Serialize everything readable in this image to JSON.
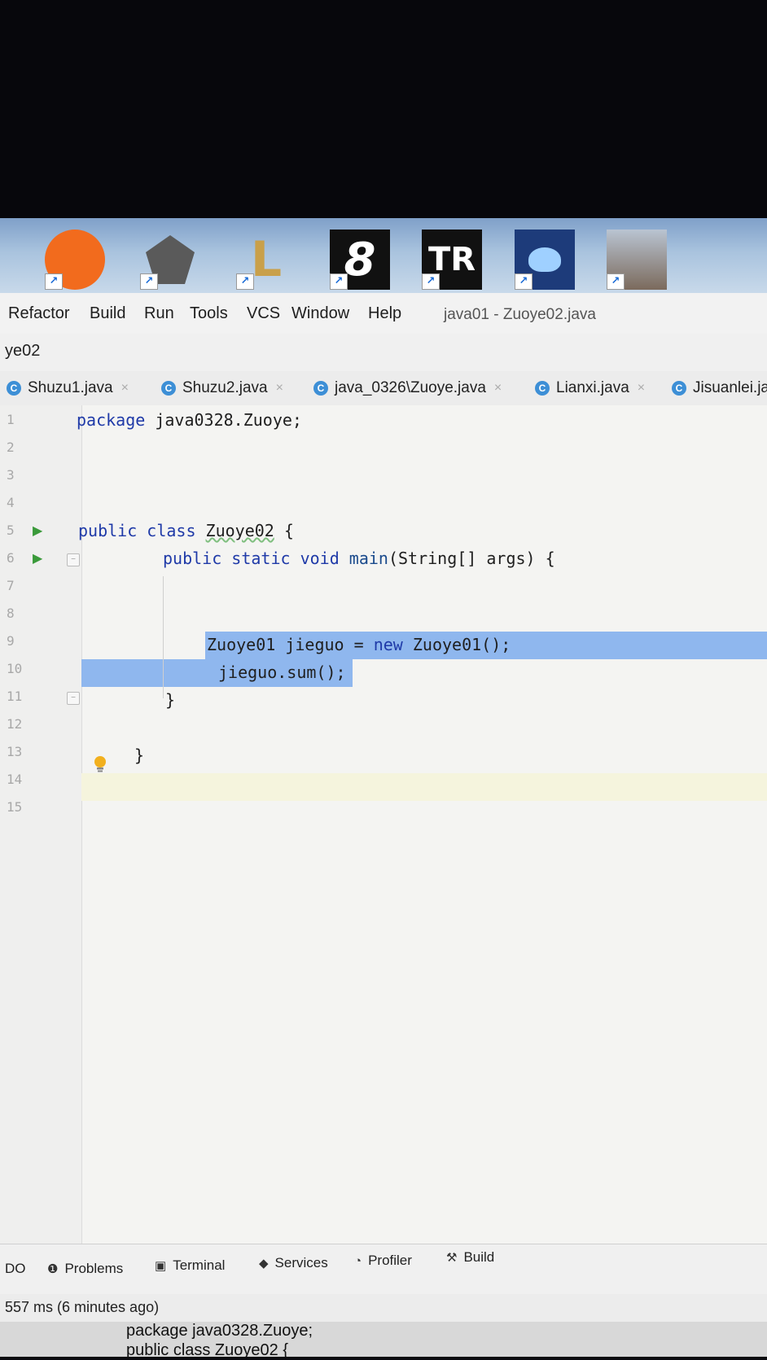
{
  "taskbar": {
    "icons": [
      {
        "name": "game-app-1-icon",
        "color": "#f26b1d",
        "text": "",
        "shortcut": "↗"
      },
      {
        "name": "witcher-app-icon",
        "color": "#555555",
        "text": "",
        "shortcut": "↗"
      },
      {
        "name": "league-of-legends-icon",
        "color": "#c9a04a",
        "text": "L",
        "shortcut": "↗"
      },
      {
        "name": "app-8-icon",
        "color": "#111111",
        "text": "8",
        "shortcut": "↗"
      },
      {
        "name": "tomb-raider-icon",
        "color": "#111111",
        "text": "TR",
        "shortcut": "↗"
      },
      {
        "name": "blue-creature-app-icon",
        "color": "#1d3b7a",
        "text": "",
        "shortcut": "↗"
      },
      {
        "name": "rise-of-tomb-raider-icon",
        "color": "#8b9bb0",
        "text": "",
        "shortcut": "↗"
      }
    ]
  },
  "menu": {
    "items": [
      "Refactor",
      "Build",
      "Run",
      "Tools",
      "VCS",
      "Window",
      "Help"
    ],
    "window_title": "java01 - Zuoye02.java"
  },
  "navbar": {
    "breadcrumb": "ye02"
  },
  "tabs": [
    {
      "label": "Shuzu1.java",
      "close": "×"
    },
    {
      "label": "Shuzu2.java",
      "close": "×"
    },
    {
      "label": "java_0326\\Zuoye.java",
      "close": "×"
    },
    {
      "label": "Lianxi.java",
      "close": "×"
    },
    {
      "label": "Jisuanlei.ja",
      "close": ""
    }
  ],
  "editor": {
    "line_numbers": [
      "1",
      "2",
      "3",
      "4",
      "5",
      "6",
      "7",
      "8",
      "9",
      "10",
      "11",
      "12",
      "13",
      "14",
      "15"
    ],
    "code": {
      "l1_kw": "package",
      "l1_rest": " java0328.Zuoye;",
      "l5_kw": "public class",
      "l5_name": "Zuoye02",
      "l5_rest": " {",
      "l6_kw": "public static void",
      "l6_fn": " main",
      "l6_rest": "(String[] args) {",
      "l9_a": "Zuoye01 jieguo = ",
      "l9_kw": "new",
      "l9_b": " Zuoye01();",
      "l10": "jieguo.sum();",
      "l11": "}",
      "l13": "}"
    }
  },
  "toolwindows": {
    "items": [
      {
        "label": "Problems",
        "icon": "problems-icon"
      },
      {
        "label": "Terminal",
        "icon": "terminal-icon"
      },
      {
        "label": "Services",
        "icon": "services-icon"
      },
      {
        "label": "Profiler",
        "icon": "profiler-icon"
      },
      {
        "label": "Build",
        "icon": "build-icon"
      }
    ],
    "left_fragment": "DO"
  },
  "status": {
    "text": "557 ms (6 minutes ago)"
  },
  "paper": {
    "line1": "package java0328.Zuoye;",
    "line2": "public class Zuoye02 {"
  }
}
